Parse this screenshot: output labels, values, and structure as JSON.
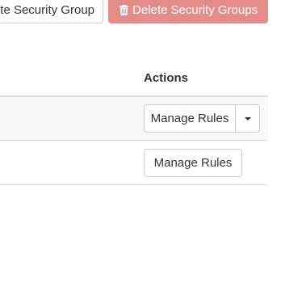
{
  "toolbar": {
    "create_label": "te Security Group",
    "delete_label": "Delete Security Groups",
    "delete_icon": "trash-icon"
  },
  "table": {
    "actions_header": "Actions",
    "rows": [
      {
        "manage_label": "Manage Rules",
        "has_dropdown": true
      },
      {
        "manage_label": "Manage Rules",
        "has_dropdown": false
      }
    ]
  },
  "colors": {
    "danger": "#e38c8a",
    "border": "#cccccc"
  }
}
